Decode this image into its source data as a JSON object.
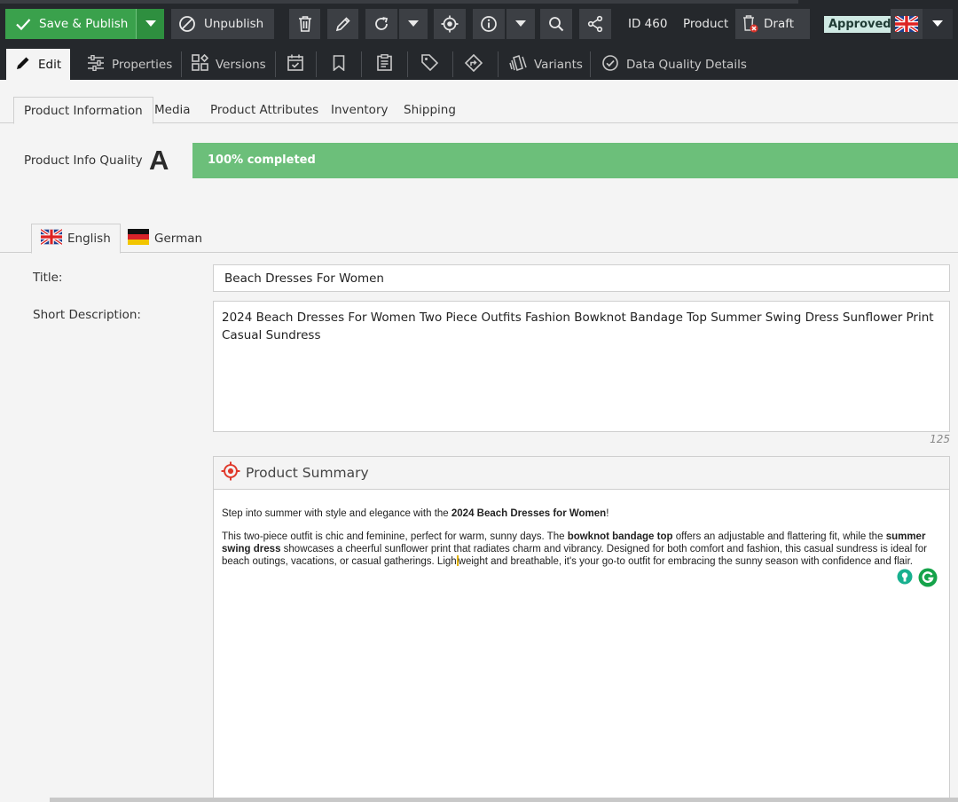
{
  "toolbar": {
    "save_label": "Save & Publish",
    "unpublish_label": "Unpublish",
    "id_label": "ID 460",
    "type_label": "Product",
    "draft_label": "Draft",
    "approved_label": "Approved",
    "icons": [
      "check-icon",
      "caret-down-icon",
      "ban-icon",
      "trash-icon",
      "pencil-icon",
      "refresh-icon",
      "caret-down-icon",
      "target-icon",
      "info-icon",
      "caret-down-icon",
      "search-icon",
      "share-icon",
      "trash-cross-icon",
      "uk-flag-icon",
      "caret-down-icon"
    ],
    "colors": {
      "save": "#3aa14c",
      "bar": "#25282c",
      "button": "#3c3f44",
      "approved_bg": "#cfe9e3"
    }
  },
  "main_tabs": [
    {
      "label": "Edit",
      "icon": "pencil-icon"
    },
    {
      "label": "Properties",
      "icon": "sliders-icon"
    },
    {
      "label": "Versions",
      "icon": "versions-icon"
    },
    {
      "label": "",
      "icon": "calendar-check-icon"
    },
    {
      "label": "",
      "icon": "bookmark-icon"
    },
    {
      "label": "",
      "icon": "clipboard-icon"
    },
    {
      "label": "",
      "icon": "tag-icon"
    },
    {
      "label": "",
      "icon": "direction-icon"
    },
    {
      "label": "Variants",
      "icon": "variants-icon"
    },
    {
      "label": "Data Quality Details",
      "icon": "check-circle-icon"
    }
  ],
  "sub_tabs": [
    "Product Information",
    "Media",
    "Product Attributes",
    "Inventory",
    "Shipping"
  ],
  "quality": {
    "label": "Product Info Quality",
    "grade": "A",
    "progress": 1.0,
    "progress_text": "100% completed",
    "color": "#6cbf7a"
  },
  "languages": [
    {
      "label": "English",
      "icon": "uk-flag-icon"
    },
    {
      "label": "German",
      "icon": "german-flag-icon"
    }
  ],
  "form": {
    "title_label": "Title:",
    "title_value": "Beach Dresses For Women",
    "short_desc_label": "Short Description:",
    "short_desc_value": "2024 Beach Dresses For Women Two Piece Outfits Fashion Bowknot Bandage Top Summer Swing Dress Sunflower Print Casual Sundress",
    "char_count": "125"
  },
  "summary": {
    "title": "Product Summary",
    "p1_a": "Step into summer with style and elegance with the ",
    "p1_b": "2024 Beach Dresses for Women",
    "p1_c": "!",
    "p2_a": "This two-piece outfit is chic and feminine, perfect for warm, sunny days. The ",
    "p2_b": "bowknot bandage top",
    "p2_c": " offers an adjustable and flattering fit, while the ",
    "p2_d": "summer swing dress",
    "p2_e": " showcases a cheerful sunflower print that radiates charm and vibrancy. Designed for both comfort and fashion, this casual sundress is ideal for beach outings, vacations, or casual gatherings. Ligh",
    "p2_f": "weight and breathable, it's your go-to outfit for embracing the sunny season with confidence and flair."
  }
}
